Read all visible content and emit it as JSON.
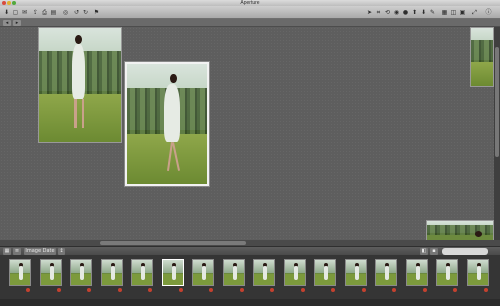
{
  "window": {
    "title": "Aperture"
  },
  "toolbar": {
    "left_icons": [
      "import-icon",
      "new-project-icon",
      "email-icon",
      "export-icon",
      "print-icon",
      "book-icon",
      "web-icon",
      "rotate-left-icon",
      "rotate-right-icon",
      "flag-icon"
    ],
    "right_icons": [
      "select-icon",
      "crop-icon",
      "straighten-icon",
      "redeye-icon",
      "spot-icon",
      "lift-icon",
      "stamp-icon",
      "brush-icon",
      "browser-view-icon",
      "split-view-icon",
      "viewer-icon",
      "fullscreen-icon",
      "inspector-icon"
    ]
  },
  "canvas": {
    "photos": [
      {
        "name": "photo-woman-standing",
        "selected": false
      },
      {
        "name": "photo-woman-walking",
        "selected": true
      },
      {
        "name": "photo-edge-right",
        "selected": false
      },
      {
        "name": "photo-edge-bottom",
        "selected": false
      }
    ]
  },
  "browser": {
    "sort_label": "Image Date",
    "search_placeholder": ""
  },
  "filmstrip": {
    "count": 16,
    "selected_index": 5
  },
  "status": {
    "text": ""
  },
  "colors": {
    "canvas": "#5e5e5e",
    "filmstrip": "#353535",
    "selection": "#ffffff",
    "label_dot": "#c4412f"
  }
}
